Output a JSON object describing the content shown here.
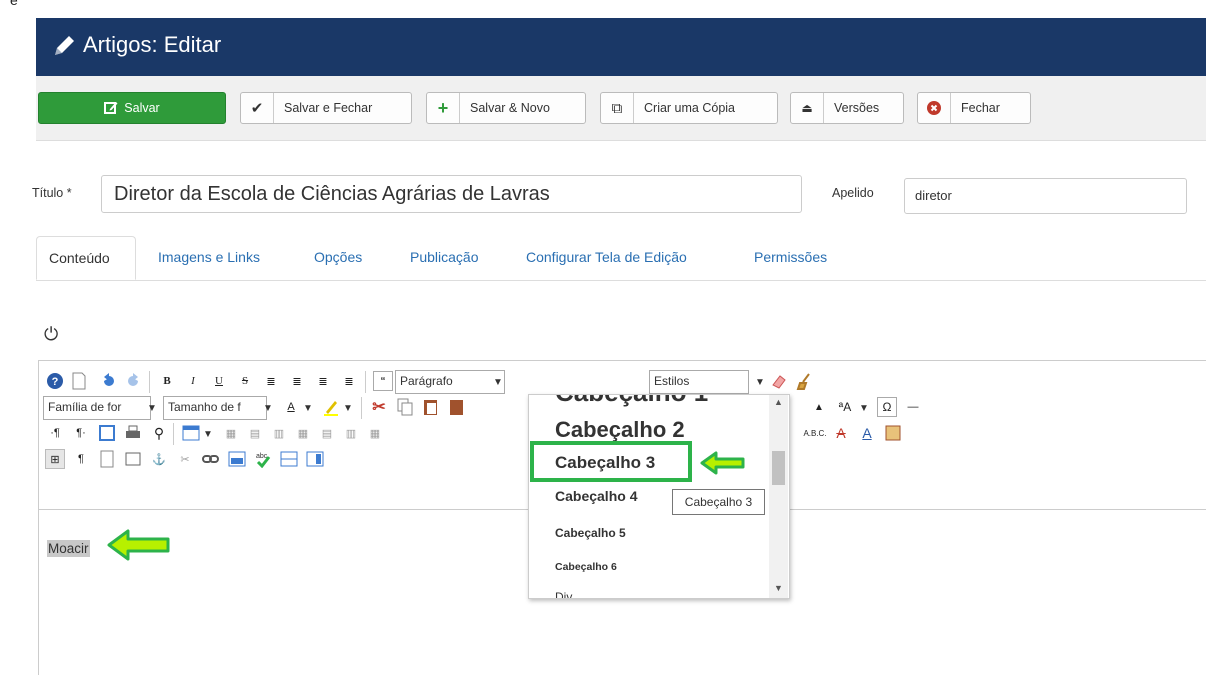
{
  "window": {
    "title": "Artigos: Editar"
  },
  "toolbar": {
    "save_label": "Salvar",
    "save_close_label": "Salvar e Fechar",
    "save_new_label": "Salvar & Novo",
    "copy_label": "Criar uma Cópia",
    "versions_label": "Versões",
    "close_label": "Fechar"
  },
  "form": {
    "title_label": "Título *",
    "title_value": "Diretor da Escola de Ciências Agrárias de Lavras",
    "alias_label": "Apelido",
    "alias_value": "diretor"
  },
  "tabs": [
    {
      "label": "Conteúdo",
      "active": true
    },
    {
      "label": "Imagens e Links"
    },
    {
      "label": "Opções"
    },
    {
      "label": "Publicação"
    },
    {
      "label": "Configurar Tela de Edição"
    },
    {
      "label": "Permissões"
    }
  ],
  "editor": {
    "format_select": "Parágrafo",
    "styles_select": "Estilos",
    "font_family_select": "Família de for",
    "font_size_select": "Tamanho de f",
    "content_text": "Moacir"
  },
  "format_dropdown": {
    "items": [
      "Cabeçalho 1",
      "Cabeçalho 2",
      "Cabeçalho 3",
      "Cabeçalho 4",
      "Cabeçalho 5",
      "Cabeçalho 6",
      "Div"
    ],
    "highlighted": "Cabeçalho 3",
    "tooltip": "Cabeçalho 3"
  },
  "colors": {
    "header": "#1a3867",
    "save": "#2f9b3a",
    "annotation": "#2db34a",
    "link": "#2a6fb2"
  },
  "icons": [
    "pencil-icon",
    "edit-icon",
    "check-icon",
    "plus-icon",
    "copy-icon",
    "versions-icon",
    "close-icon",
    "power-icon"
  ]
}
